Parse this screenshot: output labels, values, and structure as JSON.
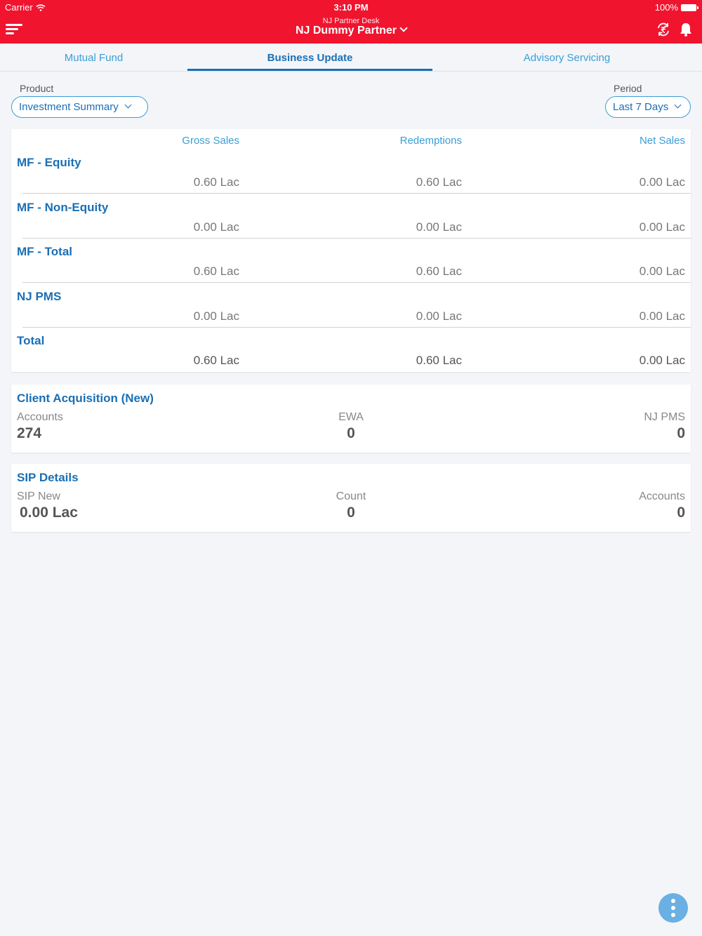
{
  "status": {
    "carrier": "Carrier",
    "time": "3:10 PM",
    "battery": "100%"
  },
  "header": {
    "subtitle": "NJ Partner Desk",
    "title": "NJ Dummy Partner"
  },
  "tabs": [
    {
      "label": "Mutual Fund"
    },
    {
      "label": "Business Update"
    },
    {
      "label": "Advisory Servicing"
    }
  ],
  "filters": {
    "product_label": "Product",
    "product_value": "Investment Summary",
    "period_label": "Period",
    "period_value": "Last 7 Days"
  },
  "summary": {
    "columns": [
      "Gross Sales",
      "Redemptions",
      "Net Sales"
    ],
    "rows": [
      {
        "label": "MF - Equity",
        "gross": "0.60 Lac",
        "redemptions": "0.60 Lac",
        "net": "0.00 Lac"
      },
      {
        "label": "MF - Non-Equity",
        "gross": "0.00 Lac",
        "redemptions": "0.00 Lac",
        "net": "0.00 Lac"
      },
      {
        "label": "MF - Total",
        "gross": "0.60 Lac",
        "redemptions": "0.60 Lac",
        "net": "0.00 Lac"
      },
      {
        "label": "NJ PMS",
        "gross": "0.00 Lac",
        "redemptions": "0.00 Lac",
        "net": "0.00 Lac"
      },
      {
        "label": "Total",
        "gross": "0.60 Lac",
        "redemptions": "0.60 Lac",
        "net": "0.00 Lac"
      }
    ]
  },
  "client_acquisition": {
    "title": "Client Acquisition (New)",
    "accounts_label": "Accounts",
    "accounts_value": "274",
    "ewa_label": "EWA",
    "ewa_value": "0",
    "pms_label": "NJ PMS",
    "pms_value": "0"
  },
  "sip": {
    "title": "SIP Details",
    "new_label": "SIP New",
    "new_value": "0.00 Lac",
    "count_label": "Count",
    "count_value": "0",
    "accounts_label": "Accounts",
    "accounts_value": "0"
  },
  "colors": {
    "brand_red": "#f0142f",
    "accent_blue": "#1a6fb5",
    "light_blue": "#3a9ed6"
  }
}
